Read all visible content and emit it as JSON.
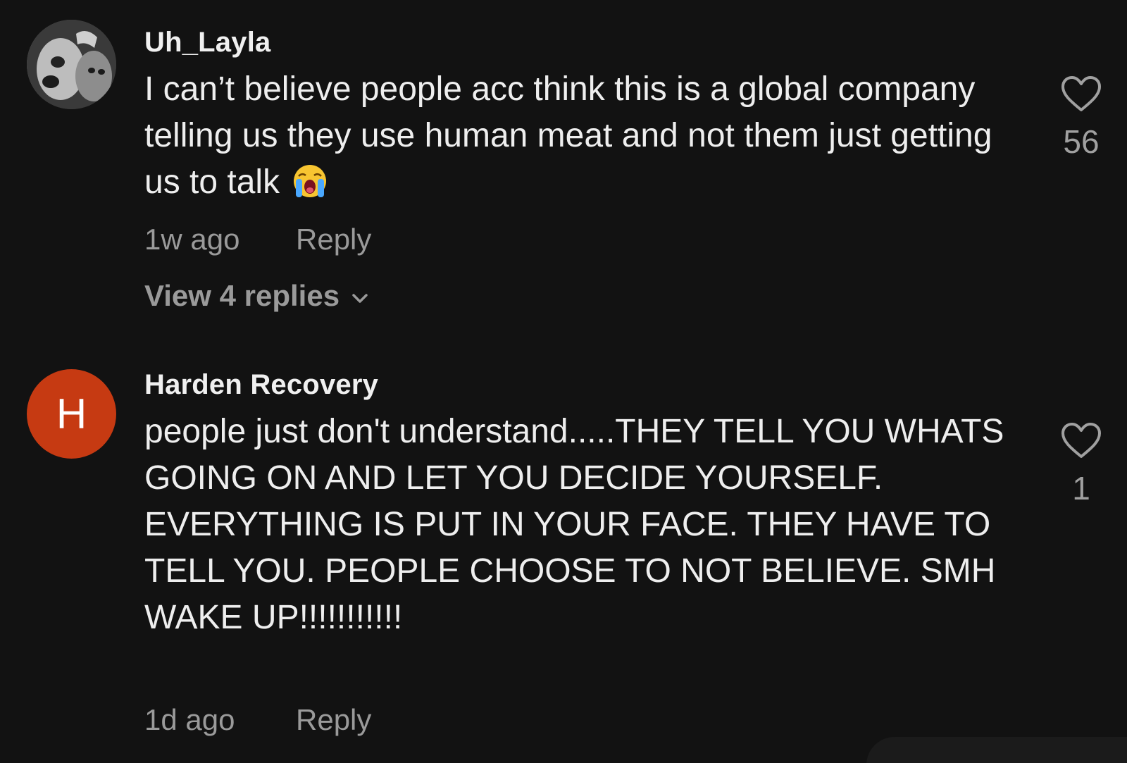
{
  "comments": [
    {
      "username": "Uh_Layla",
      "text": "I can’t believe people acc think this is a global company telling us they use human meat and not them just getting us to talk",
      "emoji": "loudly-crying-face",
      "time": "1w ago",
      "reply_label": "Reply",
      "view_replies": "View 4 replies",
      "likes": "56",
      "avatar_icon": "profile-photo"
    },
    {
      "username": "Harden Recovery",
      "avatar_initial": "H",
      "avatar_color": "#c63a12",
      "text": "people just don't understand.....THEY TELL YOU WHATS GOING ON AND LET YOU DECIDE YOURSELF. EVERYTHING IS PUT IN YOUR FACE. THEY HAVE TO TELL YOU. PEOPLE CHOOSE TO NOT BELIEVE. SMH\nWAKE UP!!!!!!!!!!!",
      "time": "1d ago",
      "reply_label": "Reply",
      "likes": "1"
    }
  ],
  "colors": {
    "background": "#121212",
    "text_primary": "#eeeeee",
    "text_secondary": "#9a9a9a"
  },
  "icons": {
    "like": "heart-outline-icon",
    "expand": "chevron-down-icon"
  }
}
